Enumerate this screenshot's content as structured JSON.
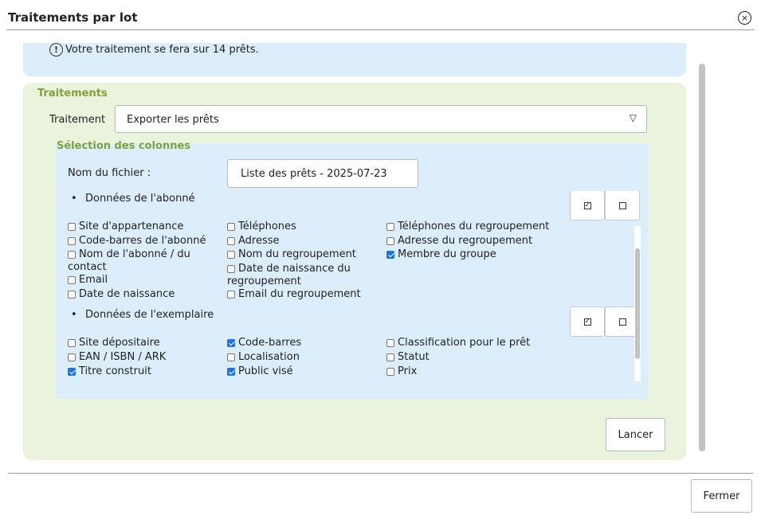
{
  "dialog": {
    "title": "Traitements par lot",
    "close_glyph": "×"
  },
  "info": {
    "icon_glyph": "!",
    "text": "Votre traitement se fera sur 14 prêts."
  },
  "treatments": {
    "section_title": "Traitements",
    "label": "Traitement",
    "selected": "Exporter les prêts",
    "arrow_glyph": "▽"
  },
  "columns": {
    "section_title": "Sélection des colonnes",
    "file_label": "Nom du fichier :",
    "file_value": "Liste des prêts - 2025-07-23",
    "subscriber": {
      "heading": "Données de l'abonné",
      "select_all_glyph": "✓",
      "items": [
        {
          "label": "Site d'appartenance",
          "checked": false
        },
        {
          "label": "Téléphones",
          "checked": false
        },
        {
          "label": "Téléphones du regroupement",
          "checked": false
        },
        {
          "label": "Code-barres de l'abonné",
          "checked": false
        },
        {
          "label": "Adresse",
          "checked": false
        },
        {
          "label": "Adresse du regroupement",
          "checked": false
        },
        {
          "label": "Nom de l'abonné / du contact",
          "checked": false
        },
        {
          "label": "Nom du regroupement",
          "checked": false
        },
        {
          "label": "Membre du groupe",
          "checked": true
        },
        {
          "label": "Email",
          "checked": false
        },
        {
          "label": "Date de naissance du regroupement",
          "checked": false
        },
        {
          "label": "Date de naissance",
          "checked": false
        },
        {
          "label": "Email du regroupement",
          "checked": false
        }
      ]
    },
    "copy": {
      "heading": "Données de l'exemplaire",
      "select_all_glyph": "✓",
      "items": [
        {
          "label": "Site dépositaire",
          "checked": false
        },
        {
          "label": "Code-barres",
          "checked": true
        },
        {
          "label": "Classification pour le prêt",
          "checked": false
        },
        {
          "label": "EAN / ISBN / ARK",
          "checked": false
        },
        {
          "label": "Localisation",
          "checked": false
        },
        {
          "label": "Statut",
          "checked": false
        },
        {
          "label": "Titre construit",
          "checked": true
        },
        {
          "label": "Public visé",
          "checked": true
        },
        {
          "label": "Prix",
          "checked": false
        }
      ]
    }
  },
  "buttons": {
    "launch": "Lancer",
    "close": "Fermer"
  }
}
